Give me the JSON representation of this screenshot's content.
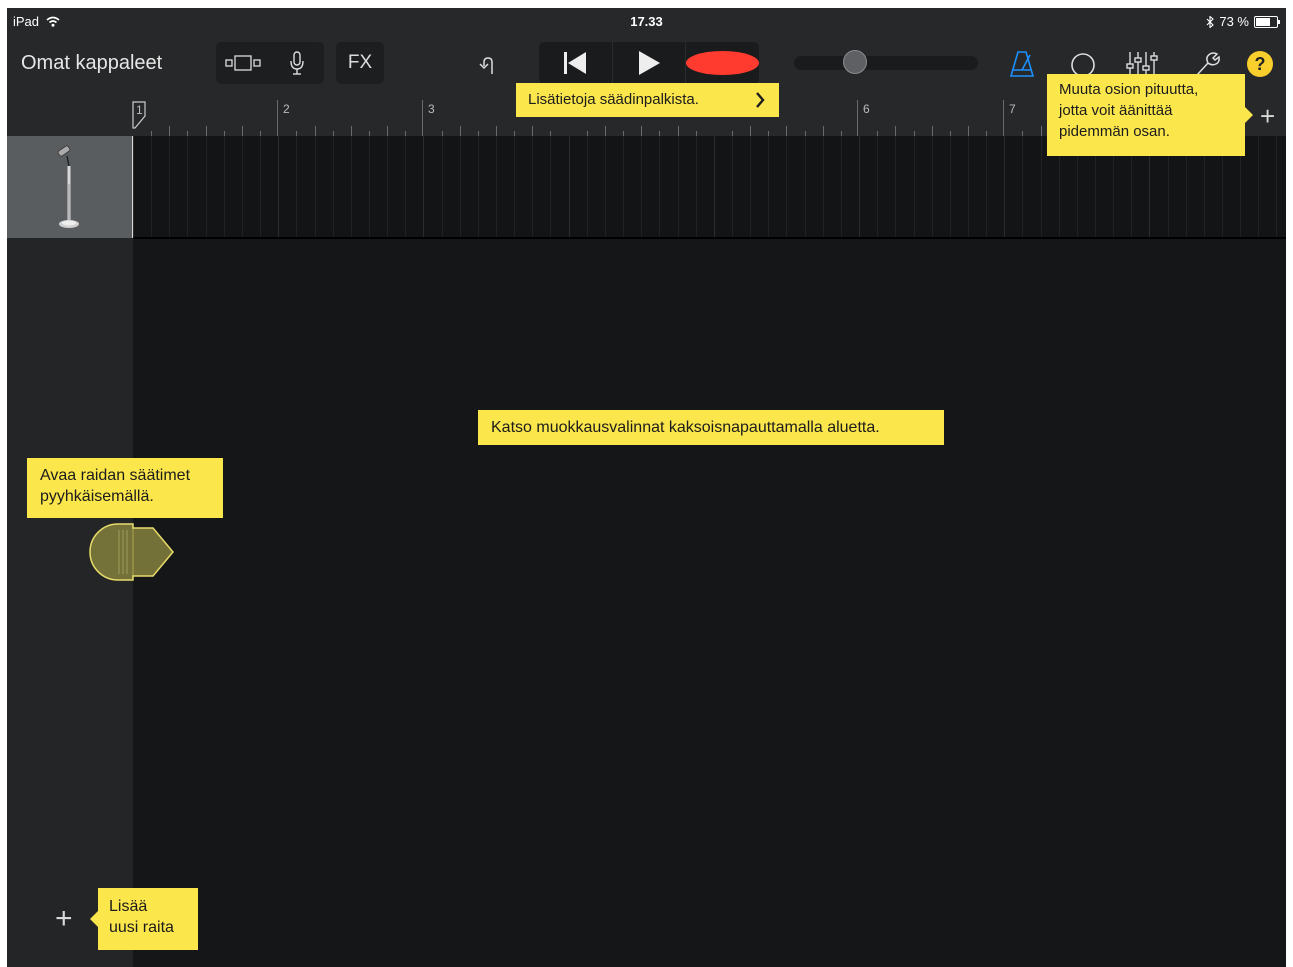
{
  "status": {
    "device": "iPad",
    "time": "17.33",
    "battery": "73 %",
    "battery_level": 0.73
  },
  "toolbar": {
    "back_label": "Omat kappaleet",
    "fx_label": "FX",
    "help_label": "?"
  },
  "ruler": {
    "bars": [
      "1",
      "2",
      "3",
      "6",
      "7"
    ]
  },
  "tooltips": {
    "controls": "Lisätietoja säädinpalkista.",
    "section_length": [
      "Muuta osion pituutta,",
      "jotta voit äänittää",
      "pidemmän osan."
    ],
    "edit": "Katso muokkausvalinnat kaksoisnapauttamalla aluetta.",
    "swipe": [
      "Avaa raidan säätimet",
      "pyyhkäisemällä."
    ],
    "add_track": [
      "Lisää",
      "uusi raita"
    ]
  },
  "colors": {
    "accent_blue": "#1e90ff",
    "record_red": "#ff3b30",
    "tooltip_yellow": "#fbe64b"
  },
  "icons": [
    "wifi-icon",
    "bluetooth-icon",
    "battery-icon",
    "view-toggle-icon",
    "microphone-icon",
    "undo-icon",
    "rewind-icon",
    "play-icon",
    "record-icon",
    "metronome-icon",
    "loop-icon",
    "mixer-icon",
    "wrench-icon",
    "help-icon",
    "mic-stand-icon",
    "swipe-hint-icon",
    "plus-icon",
    "chevron-right-icon"
  ]
}
